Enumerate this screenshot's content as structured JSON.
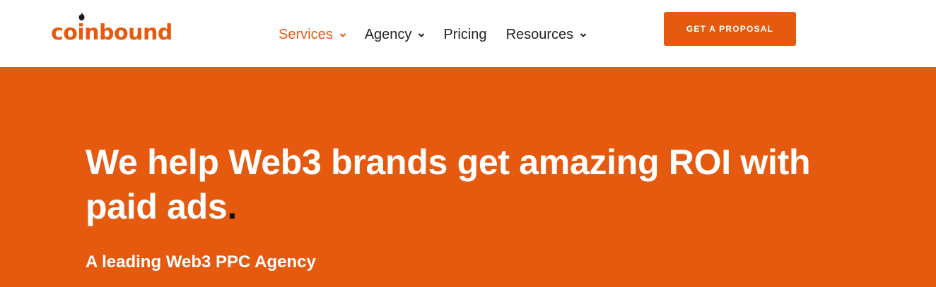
{
  "brand": {
    "name": "coinbound",
    "accent_color": "#e55a0f"
  },
  "nav": {
    "items": [
      {
        "label": "Services",
        "has_dropdown": true,
        "active": true
      },
      {
        "label": "Agency",
        "has_dropdown": true,
        "active": false
      },
      {
        "label": "Pricing",
        "has_dropdown": false,
        "active": false
      },
      {
        "label": "Resources",
        "has_dropdown": true,
        "active": false
      }
    ]
  },
  "cta": {
    "label": "GET A PROPOSAL"
  },
  "hero": {
    "title": "We help Web3 brands get amazing ROI with paid ads",
    "title_punctuation": ".",
    "subtitle": "A leading Web3 PPC Agency",
    "background_color": "#e55a0f"
  }
}
